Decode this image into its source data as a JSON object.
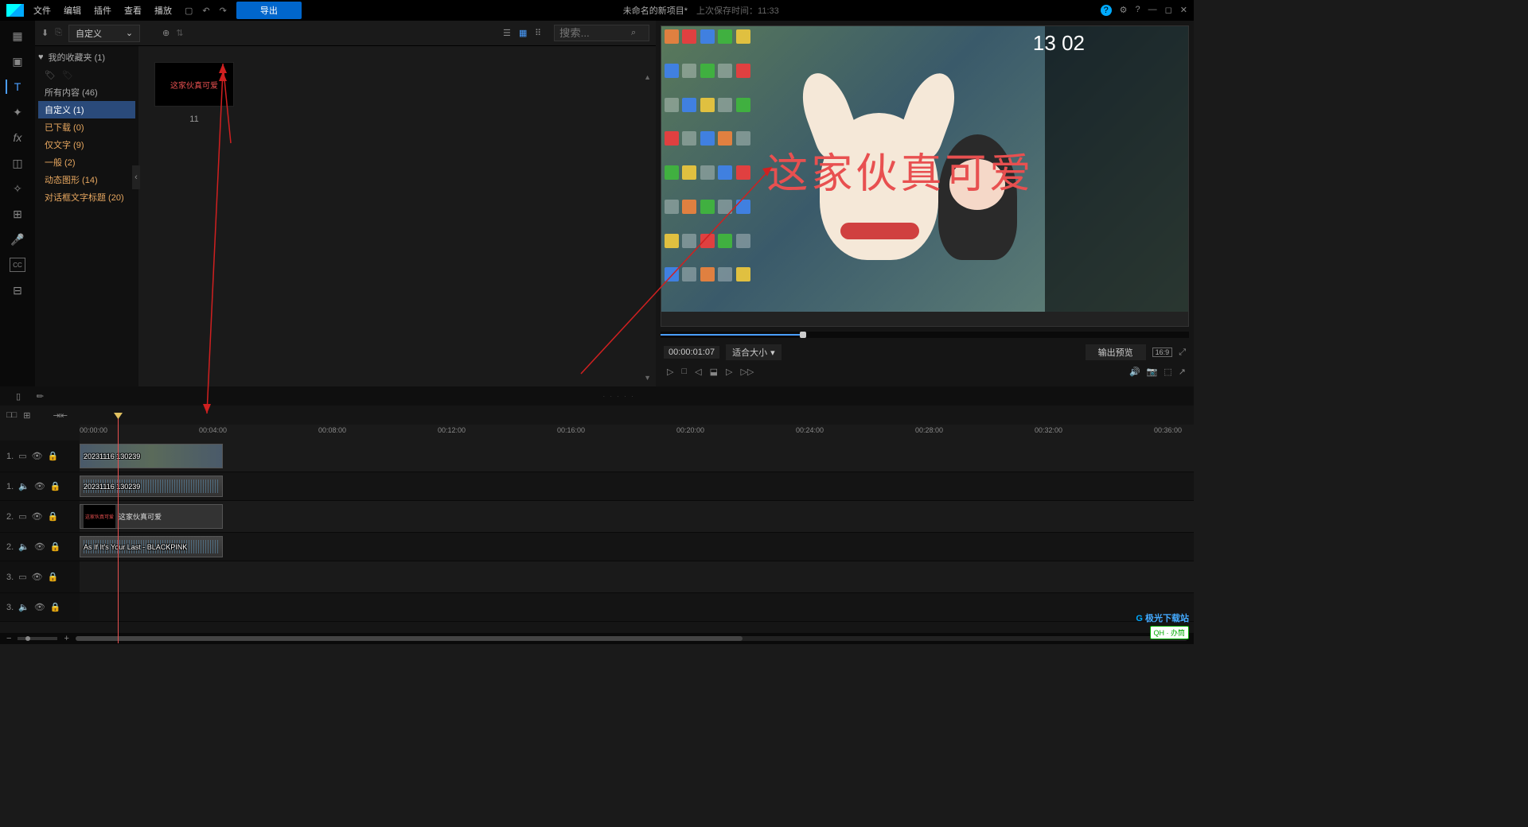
{
  "app": {
    "project_title": "未命名的新项目*",
    "saved_label": "上次保存时间：",
    "saved_time": "11:33"
  },
  "menu": {
    "file": "文件",
    "edit": "编辑",
    "plugin": "插件",
    "view": "查看",
    "play": "播放"
  },
  "export_btn": "导出",
  "browser": {
    "dropdown": "自定义",
    "search_placeholder": "搜索...",
    "fav_header": "我的收藏夹  (1)",
    "tree": [
      {
        "label": "所有内容  (46)"
      },
      {
        "label": "自定义  (1)",
        "selected": true
      },
      {
        "label": "已下载  (0)"
      },
      {
        "label": "仅文字  (9)"
      },
      {
        "label": "一般  (2)"
      },
      {
        "label": "动态图形  (14)"
      },
      {
        "label": "对话框文字标题  (20)"
      }
    ],
    "thumb_text": "这家伙真可爱",
    "thumb_label": "11"
  },
  "preview": {
    "overlay_text": "这家伙真可爱",
    "clock": "13 02",
    "timecode": "00:00:01:07",
    "fit_label": "适合大小",
    "output_preview": "输出预览",
    "aspect": "16:9"
  },
  "ruler": [
    "00:00:00",
    "00:04:00",
    "00:08:00",
    "00:12:00",
    "00:16:00",
    "00:20:00",
    "00:24:00",
    "00:28:00",
    "00:32:00",
    "00:36:00"
  ],
  "tracks": {
    "v1": {
      "head": "1.",
      "clip": "20231116 130239"
    },
    "a1": {
      "head": "1.",
      "clip": "20231116 130239"
    },
    "v2": {
      "head": "2.",
      "clip": "这家伙真可爱"
    },
    "a2": {
      "head": "2.",
      "clip": "As If It's Your Last - BLACKPINK"
    },
    "v3": {
      "head": "3."
    },
    "a3": {
      "head": "3."
    }
  },
  "watermark": {
    "site": "极光下载站",
    "badge": "QH · 办筒"
  }
}
